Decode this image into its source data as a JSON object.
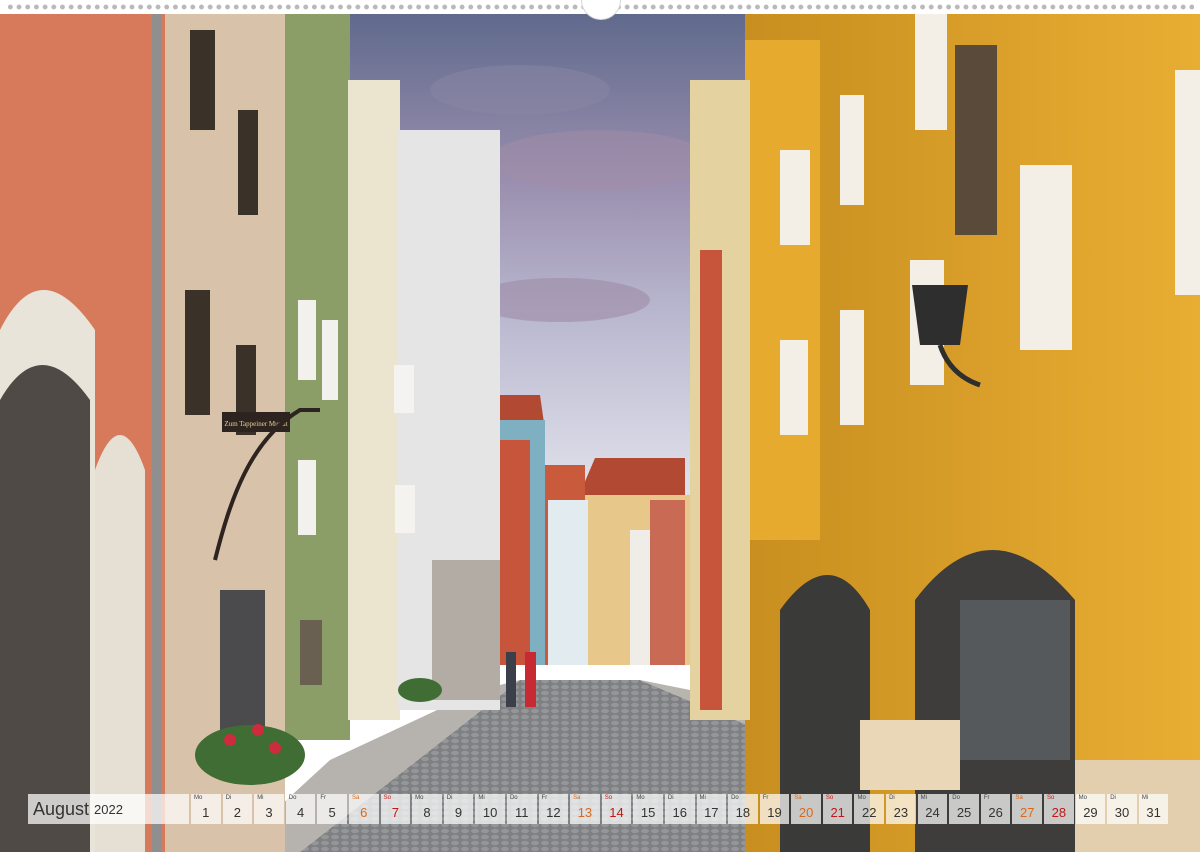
{
  "scene": {
    "description_icon": "old-town-street-photo",
    "colors": {
      "sky_top": "#5f6c8d",
      "sky_bottom": "#dfe3ec",
      "yellow_facade": "#e0a628",
      "salmon_facade": "#d97a5c",
      "green_facade": "#8a9a66",
      "cobblestone": "#8c8d8f"
    },
    "shop_sign": "Zum Tappeiner Mundt"
  },
  "calendar": {
    "month": "August",
    "year": "2022",
    "days": [
      {
        "abbr": "Mo",
        "num": "1"
      },
      {
        "abbr": "Di",
        "num": "2"
      },
      {
        "abbr": "Mi",
        "num": "3"
      },
      {
        "abbr": "Do",
        "num": "4"
      },
      {
        "abbr": "Fr",
        "num": "5"
      },
      {
        "abbr": "Sa",
        "num": "6"
      },
      {
        "abbr": "So",
        "num": "7"
      },
      {
        "abbr": "Mo",
        "num": "8"
      },
      {
        "abbr": "Di",
        "num": "9"
      },
      {
        "abbr": "Mi",
        "num": "10"
      },
      {
        "abbr": "Do",
        "num": "11"
      },
      {
        "abbr": "Fr",
        "num": "12"
      },
      {
        "abbr": "Sa",
        "num": "13"
      },
      {
        "abbr": "So",
        "num": "14"
      },
      {
        "abbr": "Mo",
        "num": "15"
      },
      {
        "abbr": "Di",
        "num": "16"
      },
      {
        "abbr": "Mi",
        "num": "17"
      },
      {
        "abbr": "Do",
        "num": "18"
      },
      {
        "abbr": "Fr",
        "num": "19"
      },
      {
        "abbr": "Sa",
        "num": "20"
      },
      {
        "abbr": "So",
        "num": "21"
      },
      {
        "abbr": "Mo",
        "num": "22"
      },
      {
        "abbr": "Di",
        "num": "23"
      },
      {
        "abbr": "Mi",
        "num": "24"
      },
      {
        "abbr": "Do",
        "num": "25"
      },
      {
        "abbr": "Fr",
        "num": "26"
      },
      {
        "abbr": "Sa",
        "num": "27"
      },
      {
        "abbr": "So",
        "num": "28"
      },
      {
        "abbr": "Mo",
        "num": "29"
      },
      {
        "abbr": "Di",
        "num": "30"
      },
      {
        "abbr": "Mi",
        "num": "31"
      }
    ]
  }
}
